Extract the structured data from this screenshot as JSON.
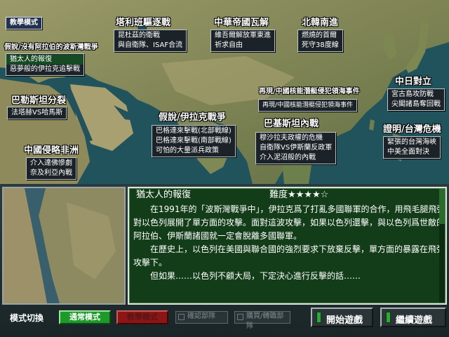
{
  "window": {
    "title": ""
  },
  "map": {
    "top_tab": "教學模式",
    "scenarios": [
      {
        "id": "afghanistan",
        "region": "塔利班驅逐戰",
        "lines": [
          "昆杜茲的衛戰",
          "與自衛隊、ISAF合流"
        ]
      },
      {
        "id": "china_collapse",
        "region": "中華帝國瓦解",
        "lines": [
          "維吾爾解放軍東進",
          "祈求自由"
        ]
      },
      {
        "id": "north_korea",
        "region": "北韓南進",
        "lines": [
          "燃燒的首爾",
          "死守38度線"
        ]
      },
      {
        "id": "gulf_hypo",
        "region": "假說/沒有阿拉伯的波斯灣戰爭",
        "lines": [
          "猶太人的報復",
          "惡夢般的伊拉克追擊戰"
        ],
        "selected_line": 0
      },
      {
        "id": "palestine",
        "region": "巴勒斯坦分裂",
        "lines": [
          "法塔赫VS哈馬斯"
        ]
      },
      {
        "id": "nuclear_reality",
        "region": "再現/中國核能潛艇侵犯領海事件",
        "lines": [
          "再現/中國核能潛艇侵犯領海事件"
        ]
      },
      {
        "id": "sino_japan",
        "region": "中日對立",
        "lines": [
          "宮古島攻防戰",
          "尖閣諸島奪回戰"
        ]
      },
      {
        "id": "iraq_hypo",
        "region": "假說/伊拉克戰爭",
        "lines": [
          "巴格達來擊戰(北部戰線)",
          "巴格達來擊戰(南部戰線)",
          "可怕的大量派兵政策"
        ]
      },
      {
        "id": "pakistan",
        "region": "巴基斯坦內戰",
        "lines": [
          "穆沙拉夫政權的危機",
          "自衛隊VS伊斯蘭反政軍",
          "介入泥沼般的內戰"
        ]
      },
      {
        "id": "taiwan",
        "region": "證明/台灣危機",
        "lines": [
          "緊張的台灣海峽",
          "中美全面對決"
        ]
      },
      {
        "id": "africa",
        "region": "中國侵略非洲",
        "lines": [
          "介入達佛慘劇",
          "奈及利亞內戰"
        ]
      }
    ]
  },
  "briefing": {
    "title": "猶太人的報復",
    "difficulty_label": "難度",
    "difficulty_value": 4,
    "difficulty_max": 5,
    "difficulty_stars": "★★★★☆",
    "paragraphs": [
      "在1991年的「波斯灣戰爭中」，伊拉克爲了打亂多國聯軍的合作，用飛毛腿飛彈對以色列展開了單方面的攻擊。面對這波攻擊，如果以色列還擊，與以色列爲世敵的阿拉伯、伊斯蘭諸國就一定會脫離多國聯軍。",
      "在歷史上，以色列在美國與聯合國的強烈要求下放棄反擊，單方面的暴露在飛彈攻擊下。",
      "但如果……以色列不顧大局，下定決心進行反擊的話……"
    ]
  },
  "bottom_bar": {
    "mode_label": "模式切換",
    "normal_mode": "通常模式",
    "teaching_mode": "教學模式",
    "deploy_check": "確認部隊",
    "purchase_deploy": "購買/轉職部隊",
    "start_game": "開始遊戲",
    "continue_game": "繼續遊戲"
  },
  "colors": {
    "map_sea": "#1f4d57",
    "map_land": "#8b8a5a",
    "briefing_bg": "#123d18",
    "normal_mode_bg": "#1d9a2a",
    "teaching_mode_bg": "#8c1616",
    "button_lamp": "#2fa83a"
  }
}
